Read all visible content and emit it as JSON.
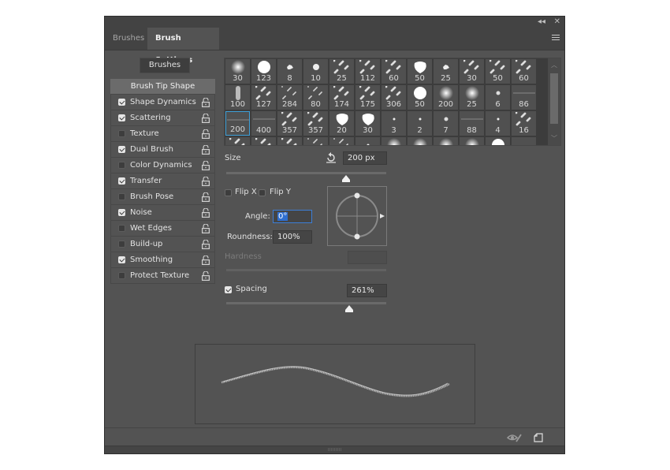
{
  "window": {
    "collapse_icon": "double-chevron-left-icon",
    "close_icon": "close-icon",
    "collapse_glyph": "◂◂",
    "close_glyph": "✕"
  },
  "tabs": [
    {
      "label": "Brushes",
      "active": false
    },
    {
      "label": "Brush Settings",
      "active": true
    }
  ],
  "sidebar": {
    "brushes_button": "Brushes",
    "header_item": "Brush Tip Shape",
    "items": [
      {
        "label": "Shape Dynamics",
        "checked": true
      },
      {
        "label": "Scattering",
        "checked": true
      },
      {
        "label": "Texture",
        "checked": false
      },
      {
        "label": "Dual Brush",
        "checked": true
      },
      {
        "label": "Color Dynamics",
        "checked": false
      },
      {
        "label": "Transfer",
        "checked": true
      },
      {
        "label": "Brush Pose",
        "checked": false
      },
      {
        "label": "Noise",
        "checked": true
      },
      {
        "label": "Wet Edges",
        "checked": false
      },
      {
        "label": "Build-up",
        "checked": false
      },
      {
        "label": "Smoothing",
        "checked": true
      },
      {
        "label": "Protect Texture",
        "checked": false
      }
    ]
  },
  "brush_presets": {
    "rows": [
      [
        "30",
        "123",
        "8",
        "10",
        "25",
        "112",
        "60",
        "50",
        "25",
        "30",
        "50",
        "60"
      ],
      [
        "100",
        "127",
        "284",
        "80",
        "174",
        "175",
        "306",
        "50",
        "200",
        "25",
        "6",
        "86"
      ],
      [
        "200",
        "400",
        "357",
        "357",
        "20",
        "30",
        "3",
        "2",
        "7",
        "88",
        "4",
        "16"
      ],
      [
        "",
        "",
        "",
        "",
        "",
        "",
        "",
        "",
        "",
        "",
        "",
        ""
      ]
    ],
    "selected": "200"
  },
  "tip": {
    "size_label": "Size",
    "size_value": "200 px",
    "size_slider_fraction": 0.75,
    "reset_icon": "reset-size-icon",
    "flip_x_label": "Flip X",
    "flip_x": false,
    "flip_y_label": "Flip Y",
    "flip_y": false,
    "angle_label": "Angle:",
    "angle_value": "0°",
    "roundness_label": "Roundness:",
    "roundness_value": "100%",
    "hardness_label": "Hardness",
    "hardness_value": "",
    "spacing_label": "Spacing",
    "spacing_checked": true,
    "spacing_value": "261%",
    "spacing_slider_fraction": 0.77
  },
  "footer": {
    "toggle_preview_icon": "eye-slash-icon",
    "new_preset_icon": "new-brush-preset-icon"
  }
}
